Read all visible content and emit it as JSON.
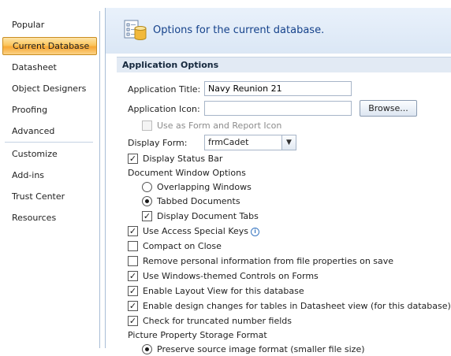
{
  "sidebar": {
    "items": [
      {
        "label": "Popular"
      },
      {
        "label": "Current Database"
      },
      {
        "label": "Datasheet"
      },
      {
        "label": "Object Designers"
      },
      {
        "label": "Proofing"
      },
      {
        "label": "Advanced"
      },
      {
        "label": "Customize"
      },
      {
        "label": "Add-ins"
      },
      {
        "label": "Trust Center"
      },
      {
        "label": "Resources"
      }
    ],
    "selected": "Current Database"
  },
  "header": {
    "title": "Options for the current database.",
    "icon": "database-options-icon"
  },
  "app_options": {
    "section_title": "Application Options",
    "app_title_label": "Application Title:",
    "app_title_value": "Navy Reunion 21",
    "app_icon_label": "Application Icon:",
    "app_icon_value": "",
    "browse_label": "Browse...",
    "use_as_form_icon_label": "Use as Form and Report Icon",
    "display_form_label": "Display Form:",
    "display_form_value": "frmCadet",
    "display_status_bar_label": "Display Status Bar",
    "doc_window_options_label": "Document Window Options",
    "overlapping_windows_label": "Overlapping Windows",
    "tabbed_documents_label": "Tabbed Documents",
    "display_document_tabs_label": "Display Document Tabs",
    "use_access_special_keys_label": "Use Access Special Keys",
    "compact_on_close_label": "Compact on Close",
    "remove_personal_info_label": "Remove personal information from file properties on save",
    "use_windows_themed_label": "Use Windows-themed Controls on Forms",
    "enable_layout_view_label": "Enable Layout View for this database",
    "enable_design_changes_label": "Enable design changes for tables in Datasheet view (for this database)",
    "check_truncated_label": "Check for truncated number fields",
    "picture_storage_label": "Picture Property Storage Format",
    "preserve_source_label": "Preserve source image format (smaller file size)"
  },
  "state": {
    "use_as_form_icon": false,
    "display_status_bar": true,
    "overlapping_windows": false,
    "tabbed_documents": true,
    "display_document_tabs": true,
    "use_access_special_keys": true,
    "compact_on_close": false,
    "remove_personal_info": false,
    "use_windows_themed": true,
    "enable_layout_view": true,
    "enable_design_changes": true,
    "check_truncated": true,
    "preserve_source": true
  },
  "colors": {
    "accent_selected": "#f7a733",
    "header_text": "#15428b",
    "section_bg": "#e2eaf4"
  }
}
